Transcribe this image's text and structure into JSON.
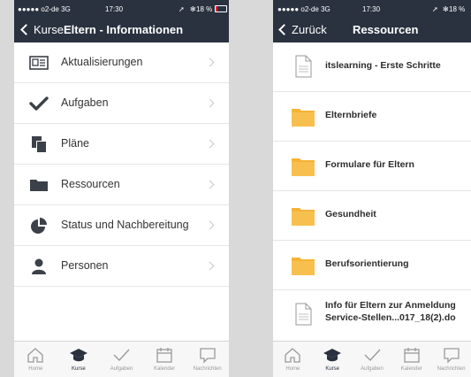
{
  "left": {
    "status": {
      "carrier": "●●●●● o2-de  3G",
      "time": "17:30",
      "battery": "18 %"
    },
    "nav": {
      "back": "Kurse",
      "title": "Eltern - Informationen"
    },
    "items": [
      {
        "label": "Aktualisierungen",
        "icon": "news-icon"
      },
      {
        "label": "Aufgaben",
        "icon": "checkmark-icon"
      },
      {
        "label": "Pläne",
        "icon": "plans-icon"
      },
      {
        "label": "Ressourcen",
        "icon": "folder-icon"
      },
      {
        "label": "Status und Nachbereitung",
        "icon": "pie-chart-icon"
      },
      {
        "label": "Personen",
        "icon": "person-icon"
      }
    ],
    "tabs": [
      "Home",
      "Kurse",
      "Aufgaben",
      "Kalender",
      "Nachrichten"
    ],
    "active_tab": "Kurse"
  },
  "right": {
    "status": {
      "carrier": "●●●●● o2-de  3G",
      "time": "17:30",
      "battery": "18 %"
    },
    "nav": {
      "back": "Zurück",
      "title": "Ressourcen"
    },
    "items": [
      {
        "label": "itslearning - Erste Schritte",
        "icon": "document-icon"
      },
      {
        "label": "Elternbriefe",
        "icon": "folder-icon"
      },
      {
        "label": "Formulare für Eltern",
        "icon": "folder-icon"
      },
      {
        "label": "Gesundheit",
        "icon": "folder-icon"
      },
      {
        "label": "Berufsorientierung",
        "icon": "folder-icon"
      },
      {
        "label": "Info für Eltern zur Anmeldung",
        "label2": "Service-Stellen...017_18(2).do",
        "icon": "document-icon"
      }
    ],
    "tabs": [
      "Home",
      "Kurse",
      "Aufgaben",
      "Kalender",
      "Nachrichten"
    ],
    "active_tab": "Kurse"
  },
  "colors": {
    "navbar": "#2a3240",
    "folder": "#f5b335",
    "icon_dark": "#3c4048",
    "tab_inactive": "#9a9a9a"
  }
}
